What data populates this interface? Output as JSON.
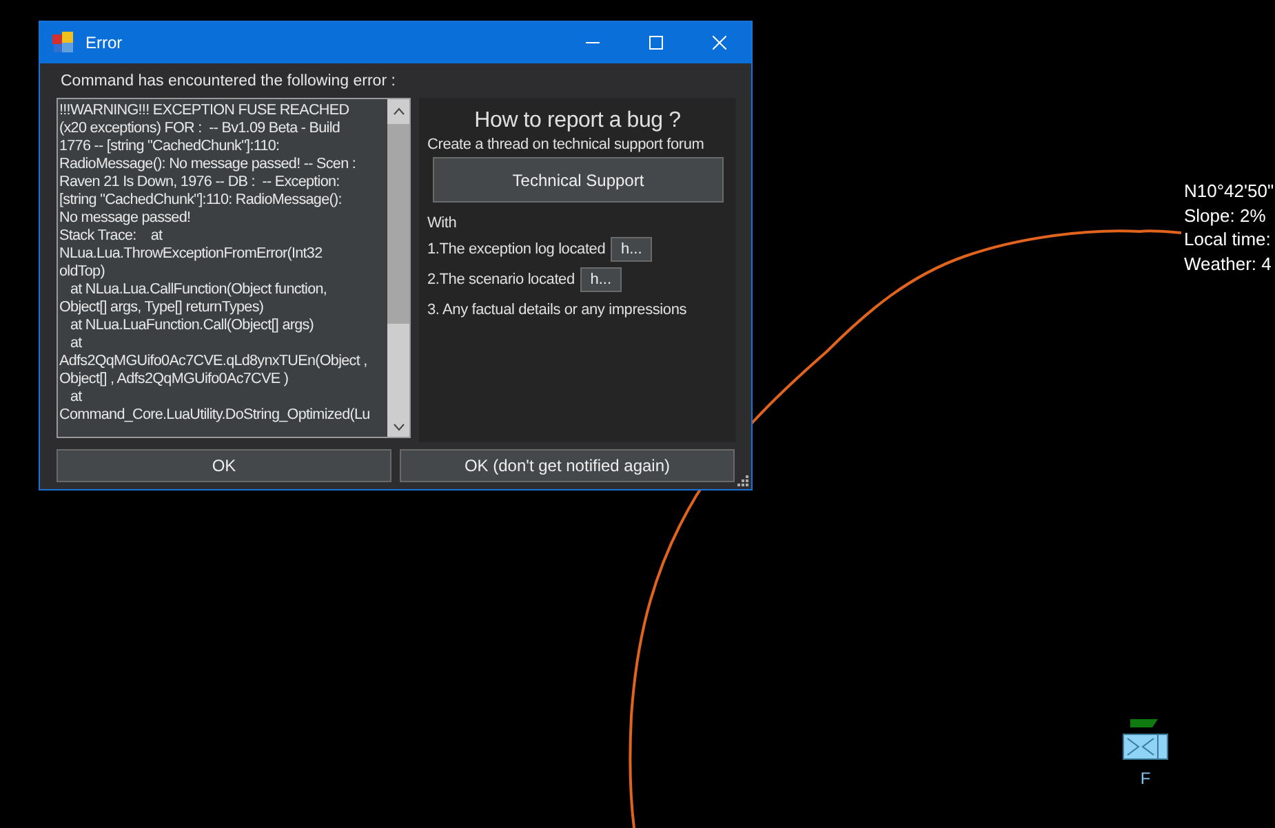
{
  "window": {
    "title": "Error"
  },
  "intro": "Command has encountered the following error :",
  "log_lines": [
    "!!!WARNING!!! EXCEPTION FUSE REACHED",
    "(x20 exceptions) FOR :  -- Bv1.09 Beta - Build",
    "1776 -- [string \"CachedChunk\"]:110:",
    "RadioMessage(): No message passed! -- Scen :",
    "Raven 21 Is Down, 1976 -- DB :  -- Exception:",
    "[string \"CachedChunk\"]:110: RadioMessage():",
    "No message passed!",
    "Stack Trace:    at",
    "NLua.Lua.ThrowExceptionFromError(Int32",
    "oldTop)",
    "   at NLua.Lua.CallFunction(Object function,",
    "Object[] args, Type[] returnTypes)",
    "   at NLua.LuaFunction.Call(Object[] args)",
    "   at",
    "Adfs2QqMGUifo0Ac7CVE.qLd8ynxTUEn(Object ,",
    "Object[] , Adfs2QqMGUifo0Ac7CVE )",
    "   at",
    "Command_Core.LuaUtility.DoString_Optimized(Lu"
  ],
  "help": {
    "heading": "How to report a bug ?",
    "subtitle": "Create a thread on technical support forum",
    "support_button": "Technical Support",
    "with": "With",
    "steps": [
      {
        "text": "1.The exception log located",
        "button": "h..."
      },
      {
        "text": "2.The scenario located",
        "button": "h..."
      },
      {
        "text": "3. Any factual details or any impressions"
      }
    ]
  },
  "buttons": [
    "OK",
    "OK (don't get notified again)"
  ],
  "map": {
    "info": [
      "N10°42'50\"",
      "Slope: 2%",
      "Local time:",
      "Weather: 4"
    ],
    "unit_label": "F"
  }
}
